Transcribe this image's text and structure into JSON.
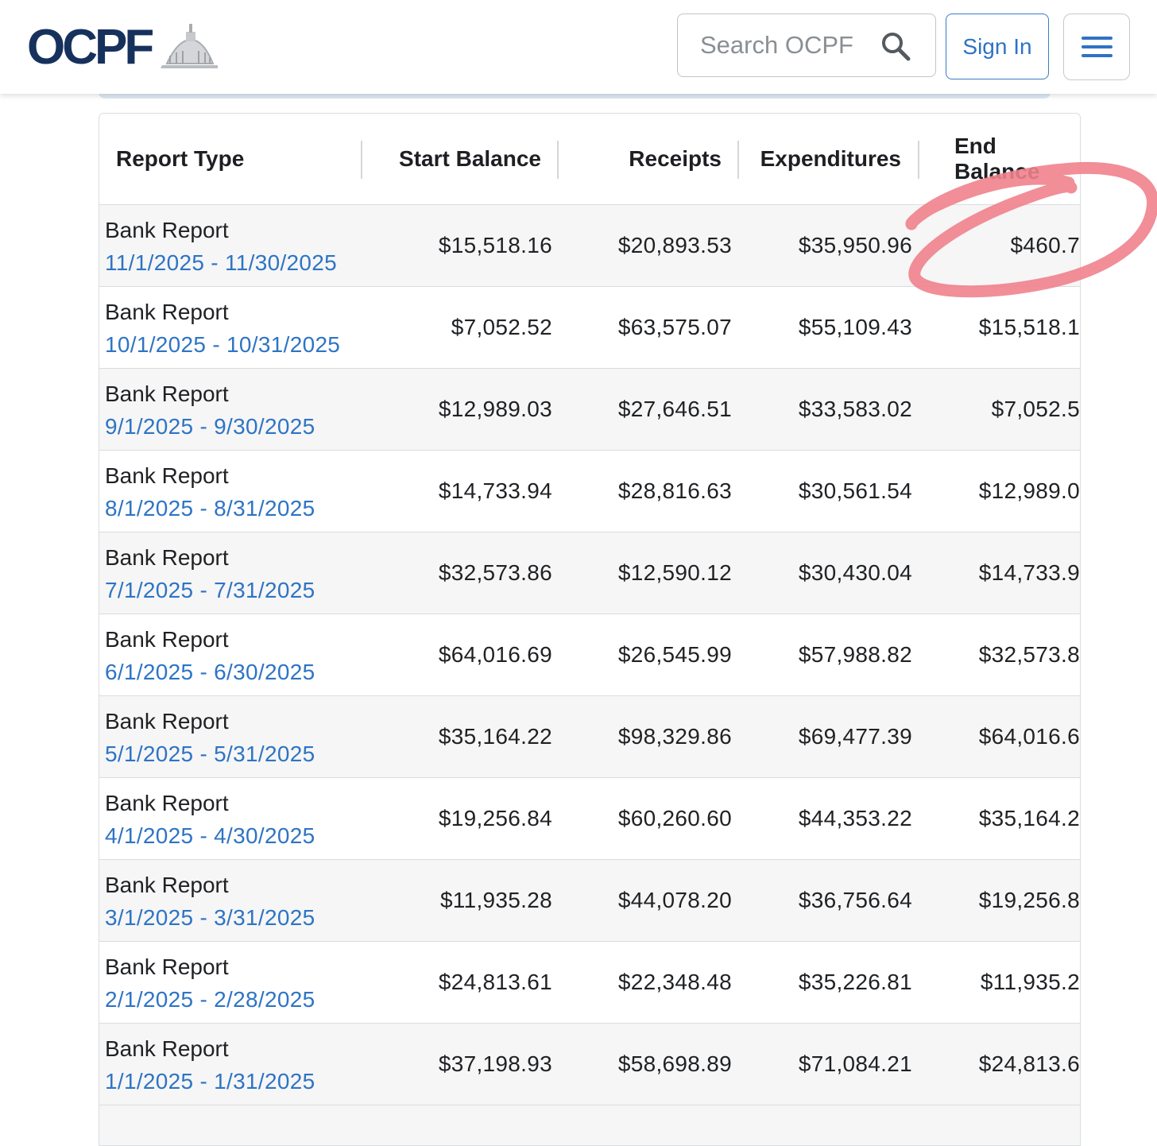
{
  "header": {
    "logo_text": "OCPF",
    "search_placeholder": "Search OCPF",
    "sign_in_label": "Sign In"
  },
  "colors": {
    "brand_navy": "#16315c",
    "brand_orange": "#e57a1d",
    "link_blue": "#2e74c4",
    "annotation_pink": "#f0828c"
  },
  "icons": [
    "search-icon",
    "hamburger-menu-icon",
    "capitol-dome-icon"
  ],
  "table": {
    "columns": [
      "Report Type",
      "Start Balance",
      "Receipts",
      "Expenditures",
      "End Balance"
    ],
    "rows": [
      {
        "type": "Bank Report",
        "period": "11/1/2025 - 11/30/2025",
        "start": "$15,518.16",
        "receipts": "$20,893.53",
        "expenditures": "$35,950.96",
        "end": "$460.7"
      },
      {
        "type": "Bank Report",
        "period": "10/1/2025 - 10/31/2025",
        "start": "$7,052.52",
        "receipts": "$63,575.07",
        "expenditures": "$55,109.43",
        "end": "$15,518.1"
      },
      {
        "type": "Bank Report",
        "period": "9/1/2025 - 9/30/2025",
        "start": "$12,989.03",
        "receipts": "$27,646.51",
        "expenditures": "$33,583.02",
        "end": "$7,052.5"
      },
      {
        "type": "Bank Report",
        "period": "8/1/2025 - 8/31/2025",
        "start": "$14,733.94",
        "receipts": "$28,816.63",
        "expenditures": "$30,561.54",
        "end": "$12,989.0"
      },
      {
        "type": "Bank Report",
        "period": "7/1/2025 - 7/31/2025",
        "start": "$32,573.86",
        "receipts": "$12,590.12",
        "expenditures": "$30,430.04",
        "end": "$14,733.9"
      },
      {
        "type": "Bank Report",
        "period": "6/1/2025 - 6/30/2025",
        "start": "$64,016.69",
        "receipts": "$26,545.99",
        "expenditures": "$57,988.82",
        "end": "$32,573.8"
      },
      {
        "type": "Bank Report",
        "period": "5/1/2025 - 5/31/2025",
        "start": "$35,164.22",
        "receipts": "$98,329.86",
        "expenditures": "$69,477.39",
        "end": "$64,016.6"
      },
      {
        "type": "Bank Report",
        "period": "4/1/2025 - 4/30/2025",
        "start": "$19,256.84",
        "receipts": "$60,260.60",
        "expenditures": "$44,353.22",
        "end": "$35,164.2"
      },
      {
        "type": "Bank Report",
        "period": "3/1/2025 - 3/31/2025",
        "start": "$11,935.28",
        "receipts": "$44,078.20",
        "expenditures": "$36,756.64",
        "end": "$19,256.8"
      },
      {
        "type": "Bank Report",
        "period": "2/1/2025 - 2/28/2025",
        "start": "$24,813.61",
        "receipts": "$22,348.48",
        "expenditures": "$35,226.81",
        "end": "$11,935.2"
      },
      {
        "type": "Bank Report",
        "period": "1/1/2025 - 1/31/2025",
        "start": "$37,198.93",
        "receipts": "$58,698.89",
        "expenditures": "$71,084.21",
        "end": "$24,813.6"
      }
    ]
  }
}
